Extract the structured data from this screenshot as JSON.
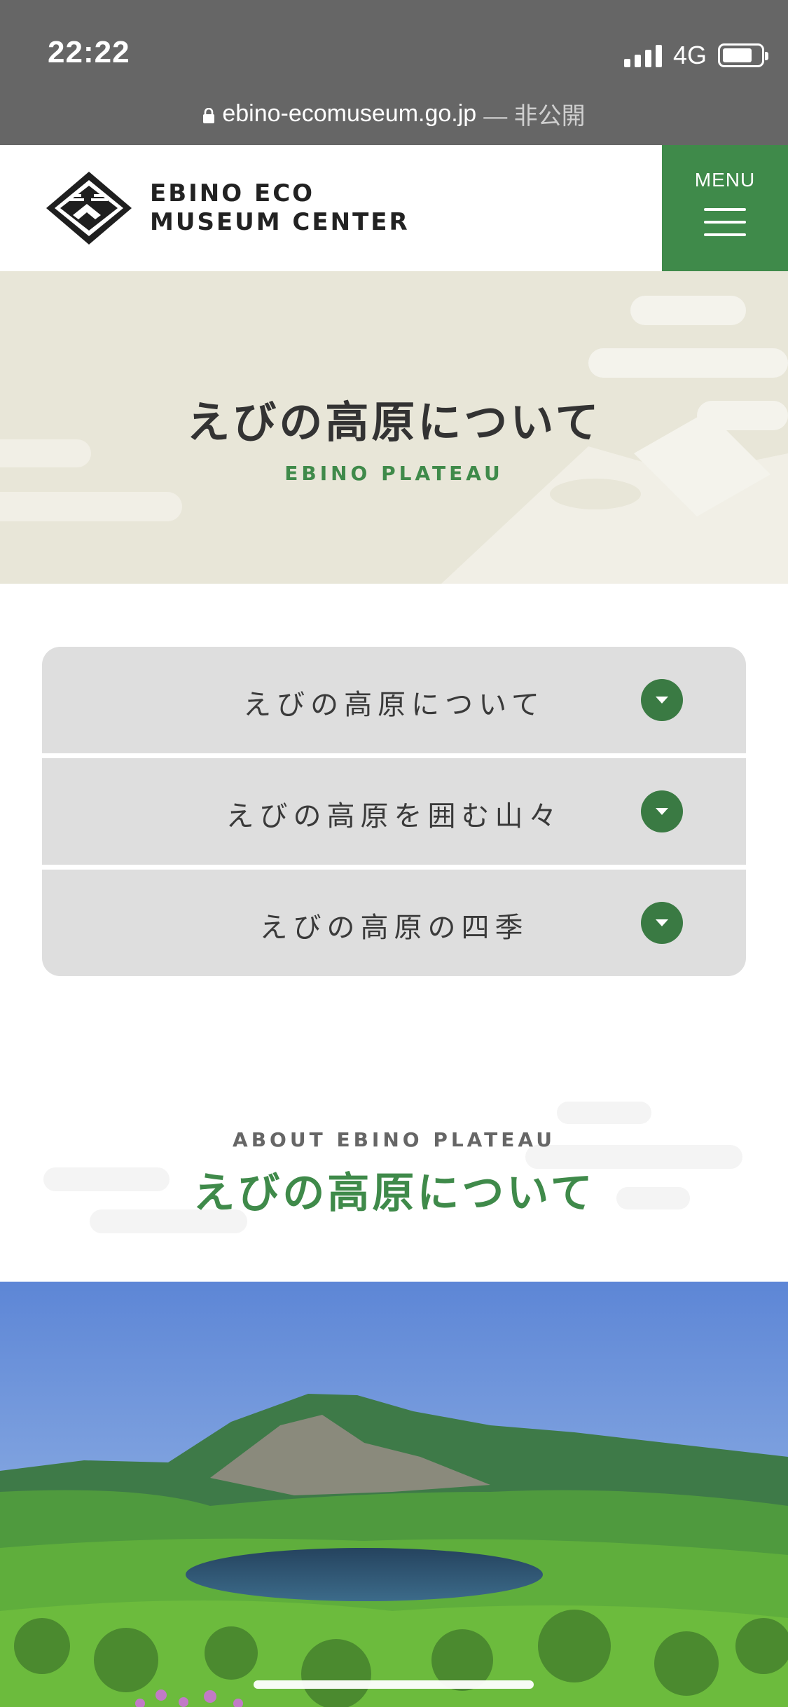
{
  "status_bar": {
    "time": "22:22",
    "network": "4G",
    "url": "ebino-ecomuseum.go.jp",
    "url_suffix": "— 非公開"
  },
  "header": {
    "logo_line1": "EBINO ECO",
    "logo_line2": "MUSEUM CENTER",
    "menu_label": "MENU"
  },
  "hero": {
    "title": "えびの高原について",
    "subtitle": "EBINO PLATEAU"
  },
  "accordion": {
    "items": [
      {
        "label": "えびの高原について"
      },
      {
        "label": "えびの高原を囲む山々"
      },
      {
        "label": "えびの高原の四季"
      }
    ]
  },
  "about": {
    "subtitle": "ABOUT EBINO PLATEAU",
    "title": "えびの高原について"
  },
  "colors": {
    "statusbar_bg": "#666666",
    "brand_green": "#3f8a4a",
    "hero_bg": "#e8e6d8",
    "accordion_bg": "#dedede"
  }
}
